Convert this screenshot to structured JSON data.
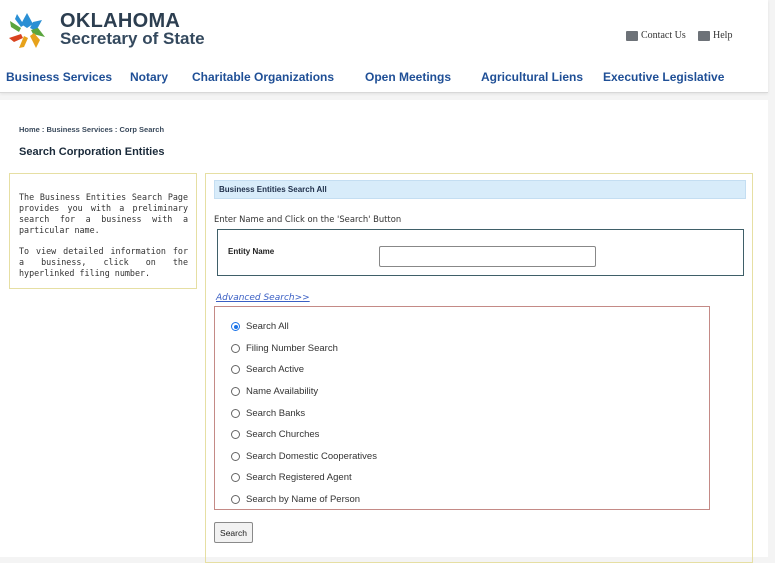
{
  "header": {
    "brand_line1": "OKLAHOMA",
    "brand_line2": "Secretary of State",
    "contact_label": "Contact Us",
    "help_label": "Help",
    "logo_icon": "oklahoma-star-logo-icon"
  },
  "nav": {
    "items": [
      {
        "label": "Business Services"
      },
      {
        "label": "Notary"
      },
      {
        "label": "Charitable Organizations"
      },
      {
        "label": "Open Meetings"
      },
      {
        "label": "Agricultural Liens"
      },
      {
        "label": "Executive Legislative"
      }
    ]
  },
  "breadcrumb": "Home : Business Services : Corp Search",
  "page_title": "Search Corporation Entities",
  "info": {
    "para1": "The Business Entities Search Page provides you with a preliminary search for a business with a particular name.",
    "para2": "To view detailed information for a business, click on the hyperlinked filing number."
  },
  "panel": {
    "section_title": "Business Entities Search All",
    "instructions": "Enter Name and Click on the 'Search' Button",
    "entity_label": "Entity Name",
    "entity_value": "",
    "advanced_link": "Advanced Search>>",
    "options": [
      {
        "label": "Search All",
        "checked": true
      },
      {
        "label": "Filing Number Search",
        "checked": false
      },
      {
        "label": "Search Active",
        "checked": false
      },
      {
        "label": "Name Availability",
        "checked": false
      },
      {
        "label": "Search Banks",
        "checked": false
      },
      {
        "label": "Search Churches",
        "checked": false
      },
      {
        "label": "Search Domestic Cooperatives",
        "checked": false
      },
      {
        "label": "Search Registered Agent",
        "checked": false
      },
      {
        "label": "Search by Name of Person",
        "checked": false
      }
    ],
    "search_button": "Search"
  },
  "colors": {
    "nav_link": "#1f4f96",
    "section_header_bg": "#d8ecfa",
    "panel_border": "#e6dfa3",
    "options_border": "#c48a86",
    "radio_accent": "#1a73e8"
  }
}
